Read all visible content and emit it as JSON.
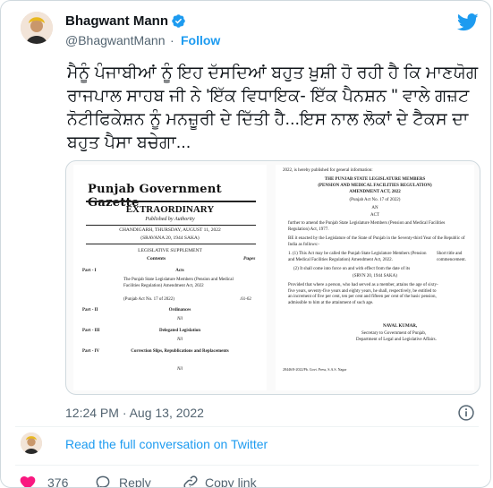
{
  "header": {
    "name": "Bhagwant Mann",
    "handle": "@BhagwantMann",
    "separator": "·",
    "follow_label": "Follow"
  },
  "tweet": {
    "text": "ਮੈਨੂੰ ਪੰਜਾਬੀਆਂ ਨੂੰ ਇਹ ਦੱਸਦਿਆਂ ਬਹੁਤ ਖ਼ੁਸ਼ੀ ਹੋ ਰਹੀ ਹੈ ਕਿ ਮਾਣਯੋਗ ਰਾਜਪਾਲ ਸਾਹਬ ਜੀ ਨੇ 'ਇੱਕ ਵਿਧਾਇਕ- ਇੱਕ ਪੈਨਸ਼ਨ \" ਵਾਲੇ ਗਜ਼ਟ ਨੋਟੀਫਿਕੇਸ਼ਨ ਨੂੰ ਮਨਜ਼ੂਰੀ ਦੇ ਦਿੱਤੀ ਹੈ...ਇਸ ਨਾਲ ਲੋਕਾਂ ਦੇ ਟੈਕਸ ਦਾ ਬਹੁਤ ਪੈਸਾ ਬਚੇਗਾ..."
  },
  "gazette": {
    "title": "Punjab Government Gazette",
    "extraordinary": "EXTRAORDINARY",
    "published": "Published by Authority",
    "date": "CHANDIGARH, THURSDAY, AUGUST 11, 2022",
    "saka": "(SRAVANA 20, 1944 SAKA)",
    "supplement": "LEGISLATIVE SUPPLEMENT",
    "contents": "Contents",
    "pages": "Pages",
    "part1": "Part - I",
    "acts": "Acts",
    "act_name": "The Punjab State Legislature Members (Pension and Medical Facilities Regulation) Amendment Act, 2022",
    "act_no": "(Punjab Act No. 17 of 2022)",
    "act_pages": ".61-62",
    "part2": "Part - II",
    "ordinances": "Ordinances",
    "nil": "Nil",
    "part3": "Part - III",
    "delegated": "Delegated Legislation",
    "part4": "Part - IV",
    "corrections": "Correction Slips, Republications and Replacements"
  },
  "gazette_right": {
    "top": "2022, is hereby published for general information:",
    "heading1": "THE PUNJAB STATE LEGISLATURE MEMBERS",
    "heading2": "(PENSION AND MEDICAL FACILITIES REGULATION)",
    "heading3": "AMENDMENT ACT, 2022",
    "act_no": "(Punjab Act No. 17 of 2022)",
    "an": "AN",
    "act": "ACT",
    "p1": "further to amend the Punjab State Legislature Members (Pension and Medical Facilities Regulation) Act, 1977.",
    "p2": "BE it enacted by the Legislature of the State of Punjab in the Seventy-third Year of the Republic of India as follows:-",
    "s1": "1. (1) This Act may be called the Punjab State Legislature Members (Pension and Medical Facilities Regulation) Amendment Act, 2022.",
    "side": "Short title and commencement.",
    "s2": "(2) It shall come into force on and with effect from the date of its",
    "s2b": "(SRVN 20, 1944 SAKA)",
    "p3": "Provided that where a person, who had served as a member, attains the age of sixty-five years, seventy-five years and eighty years, he shall, respectively, be entitled to an increment of five per cent, ten per cent and fifteen per cent of the basic pension, admissible to him at the attainment of such age.",
    "signer": "NAVAL KUMAR,",
    "sig1": "Secretary to Government of Punjab,",
    "sig2": "Department of Legal and Legislative Affairs.",
    "footer": "28446/8-2022/Pb. Govt. Press, S.A.S. Nagar"
  },
  "meta": {
    "timestamp": "12:24 PM · Aug 13, 2022",
    "read_full": "Read the full conversation on Twitter"
  },
  "actions": {
    "likes": "376",
    "reply": "Reply",
    "copy_link": "Copy link"
  },
  "colors": {
    "accent": "#1d9bf0",
    "text": "#0f1419",
    "muted": "#536471",
    "border": "#cfd9de",
    "like": "#f91880"
  }
}
